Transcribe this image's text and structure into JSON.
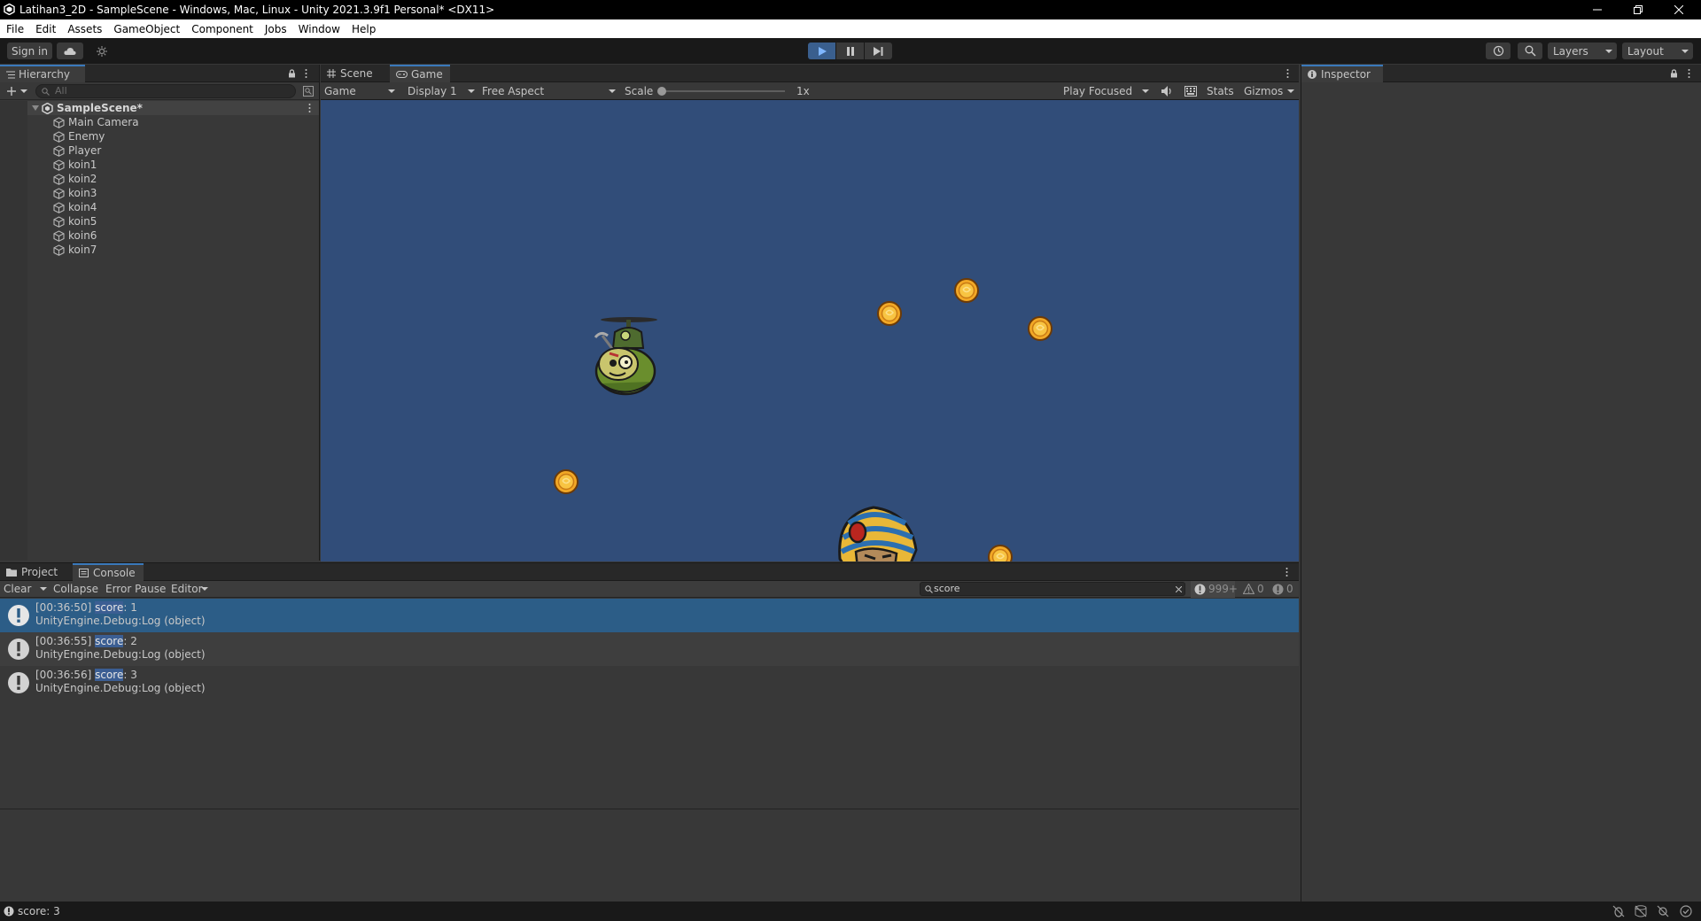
{
  "window": {
    "title": "Latihan3_2D - SampleScene - Windows, Mac, Linux - Unity 2021.3.9f1 Personal* <DX11>"
  },
  "menu": [
    "File",
    "Edit",
    "Assets",
    "GameObject",
    "Component",
    "Jobs",
    "Window",
    "Help"
  ],
  "toolbar": {
    "sign_in": "Sign in",
    "layers": "Layers",
    "layout": "Layout"
  },
  "hierarchy": {
    "tab": "Hierarchy",
    "search_placeholder": "All",
    "scene": "SampleScene*",
    "items": [
      "Main Camera",
      "Enemy",
      "Player",
      "koin1",
      "koin2",
      "koin3",
      "koin4",
      "koin5",
      "koin6",
      "koin7"
    ]
  },
  "view_tabs": {
    "scene": "Scene",
    "game": "Game"
  },
  "game_toolbar": {
    "mode": "Game",
    "display": "Display 1",
    "aspect": "Free Aspect",
    "scale_label": "Scale",
    "scale_value": "1x",
    "play_mode": "Play Focused",
    "stats": "Stats",
    "gizmos": "Gizmos"
  },
  "inspector": {
    "tab": "Inspector"
  },
  "bottom_tabs": {
    "project": "Project",
    "console": "Console"
  },
  "console_toolbar": {
    "clear": "Clear",
    "collapse": "Collapse",
    "error_pause": "Error Pause",
    "editor": "Editor",
    "search_value": "score",
    "log_count": "999+",
    "warn_count": "0",
    "error_count": "0"
  },
  "logs": [
    {
      "time": "[00:36:50]",
      "keyword": "score",
      "rest": ": 1",
      "trace": "UnityEngine.Debug:Log (object)"
    },
    {
      "time": "[00:36:55]",
      "keyword": "score",
      "rest": ": 2",
      "trace": "UnityEngine.Debug:Log (object)"
    },
    {
      "time": "[00:36:56]",
      "keyword": "score",
      "rest": ": 3",
      "trace": "UnityEngine.Debug:Log (object)"
    }
  ],
  "statusbar": {
    "message": "score: 3"
  },
  "colors": {
    "game_background": "#314d79",
    "selection": "#2c5d87",
    "accent": "#3a79bb"
  }
}
